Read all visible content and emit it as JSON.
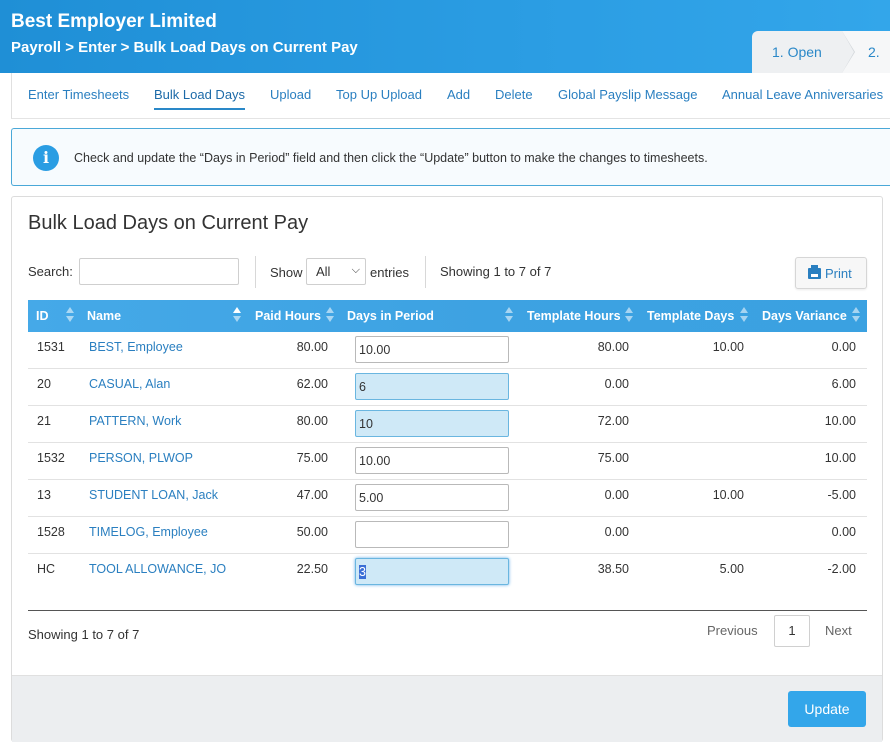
{
  "header": {
    "company": "Best Employer Limited",
    "breadcrumb": "Payroll > Enter > Bulk Load Days on Current Pay",
    "steps": [
      "1. Open",
      "2."
    ]
  },
  "tabs": [
    {
      "label": "Enter Timesheets",
      "active": false
    },
    {
      "label": "Bulk Load Days",
      "active": true
    },
    {
      "label": "Upload",
      "active": false
    },
    {
      "label": "Top Up Upload",
      "active": false
    },
    {
      "label": "Add",
      "active": false
    },
    {
      "label": "Delete",
      "active": false
    },
    {
      "label": "Global Payslip Message",
      "active": false
    },
    {
      "label": "Annual Leave Anniversaries",
      "active": false
    }
  ],
  "info": {
    "icon": "info-icon",
    "message": "Check and update the “Days in Period” field and then click the “Update” button to make the changes to timesheets."
  },
  "panel": {
    "title": "Bulk Load Days on Current Pay",
    "search_label": "Search:",
    "search_value": "",
    "show_label": "Show",
    "show_selected": "All",
    "entries_label": "entries",
    "showing_top": "Showing 1 to 7 of 7",
    "print_label": "Print",
    "showing_bottom": "Showing 1 to 7 of 7",
    "previous_label": "Previous",
    "current_page": "1",
    "next_label": "Next",
    "update_label": "Update"
  },
  "table": {
    "columns": [
      "ID",
      "Name",
      "Paid Hours",
      "Days in Period",
      "Template Hours",
      "Template Days",
      "Days Variance"
    ],
    "rows": [
      {
        "id": "1531",
        "name": "BEST, Employee",
        "paid_hours": "80.00",
        "days_in_period": "10.00",
        "template_hours": "80.00",
        "template_days": "10.00",
        "days_variance": "0.00",
        "changed": false
      },
      {
        "id": "20",
        "name": "CASUAL, Alan",
        "paid_hours": "62.00",
        "days_in_period": "6",
        "template_hours": "0.00",
        "template_days": "",
        "days_variance": "6.00",
        "changed": true
      },
      {
        "id": "21",
        "name": "PATTERN, Work",
        "paid_hours": "80.00",
        "days_in_period": "10",
        "template_hours": "72.00",
        "template_days": "",
        "days_variance": "10.00",
        "changed": true
      },
      {
        "id": "1532",
        "name": "PERSON, PLWOP",
        "paid_hours": "75.00",
        "days_in_period": "10.00",
        "template_hours": "75.00",
        "template_days": "",
        "days_variance": "10.00",
        "changed": false
      },
      {
        "id": "13",
        "name": "STUDENT LOAN, Jack",
        "paid_hours": "47.00",
        "days_in_period": "5.00",
        "template_hours": "0.00",
        "template_days": "10.00",
        "days_variance": "-5.00",
        "changed": false
      },
      {
        "id": "1528",
        "name": "TIMELOG, Employee",
        "paid_hours": "50.00",
        "days_in_period": "",
        "template_hours": "0.00",
        "template_days": "",
        "days_variance": "0.00",
        "changed": false
      },
      {
        "id": "HC",
        "name": "TOOL ALLOWANCE, JO",
        "paid_hours": "22.50",
        "days_in_period": "3",
        "template_hours": "38.50",
        "template_days": "5.00",
        "days_variance": "-2.00",
        "changed": true
      }
    ]
  }
}
